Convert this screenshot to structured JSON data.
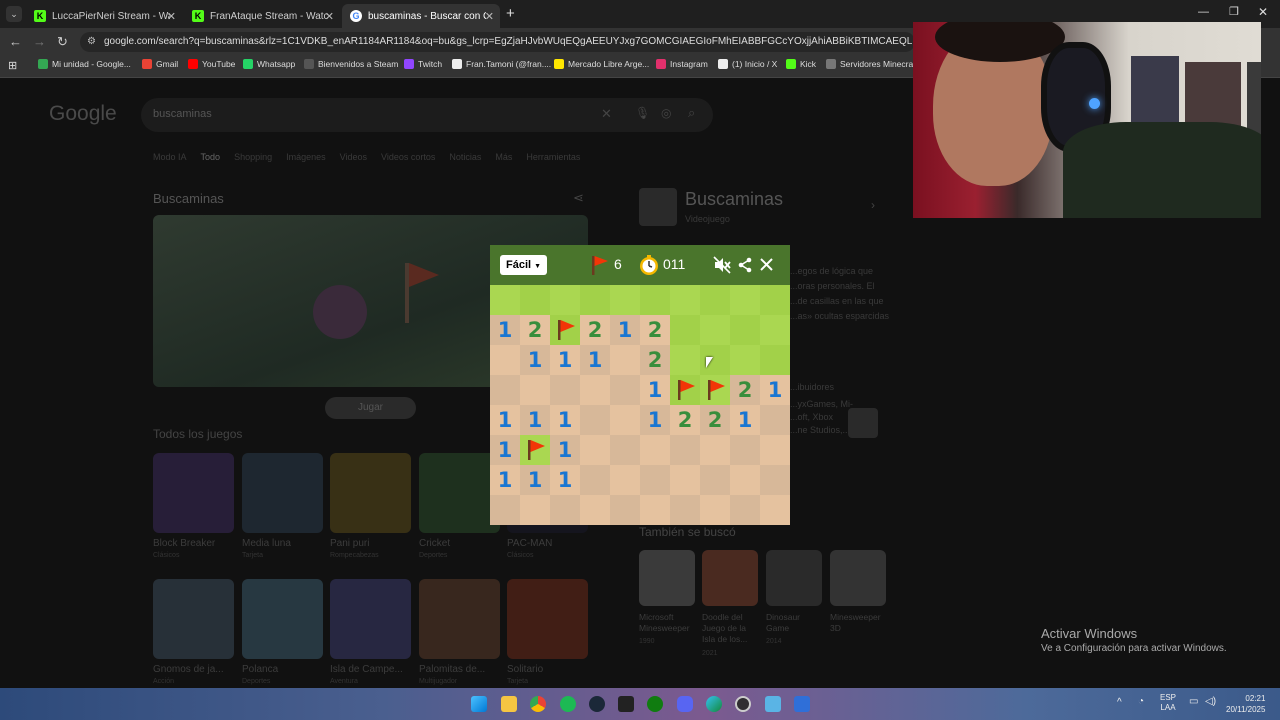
{
  "browser": {
    "tabs": [
      {
        "title": "LuccaPierNeri Stream - Watch L",
        "favicon_color": "#53fc18"
      },
      {
        "title": "FranAtaque Stream - Watch Live",
        "favicon_color": "#53fc18"
      },
      {
        "title": "buscaminas - Buscar con Goog",
        "favicon_color": "#ffffff"
      }
    ],
    "new_tab": "+",
    "url": "google.com/search?q=buscaminas&rlz=1C1VDKB_enAR1184AR1184&oq=bu&gs_lcrp=EgZjaHJvbWUqEQgAEEUYJxg7GOMCGIAEGIoFMhEIABBFGCcYOxjjAhiABBiKBTIMCAEQLhgnGIAEGIoFMg8IARAA",
    "bookmarks": [
      {
        "label": "Mi unidad - Google...",
        "color": "#34a853"
      },
      {
        "label": "Gmail",
        "color": "#ea4335"
      },
      {
        "label": "YouTube",
        "color": "#ff0000"
      },
      {
        "label": "Whatsapp",
        "color": "#25d366"
      },
      {
        "label": "Bienvenidos a Steam",
        "color": "#1b2838"
      },
      {
        "label": "Twitch",
        "color": "#9146ff"
      },
      {
        "label": "Fran.Tamoni (@fran....",
        "color": "#000000"
      },
      {
        "label": "Mercado Libre Arge...",
        "color": "#ffe600"
      },
      {
        "label": "Instagram",
        "color": "#e1306c"
      },
      {
        "label": "(1) Inicio / X",
        "color": "#000000"
      },
      {
        "label": "Kick",
        "color": "#53fc18"
      },
      {
        "label": "Servidores Minecraf...",
        "color": "#777777"
      }
    ]
  },
  "search": {
    "logo": "Google",
    "query": "buscaminas",
    "nav": [
      "Modo IA",
      "Todo",
      "Shopping",
      "Imágenes",
      "Videos",
      "Videos cortos",
      "Noticias",
      "Más",
      "Herramientas"
    ],
    "game_title": "Buscaminas",
    "play_button": "Jugar",
    "all_games_heading": "Todos los juegos",
    "games": [
      {
        "name": "Block Breaker",
        "sub": "Clásicos",
        "color": "#3a2a5a"
      },
      {
        "name": "Media luna",
        "sub": "Tarjeta",
        "color": "#2a3a4a"
      },
      {
        "name": "Pani puri",
        "sub": "Rompecabezas",
        "color": "#5a4a1a"
      },
      {
        "name": "Cricket",
        "sub": "Deportes",
        "color": "#2a4a2a"
      },
      {
        "name": "PAC-MAN",
        "sub": "Clásicos",
        "color": "#1a1a2a"
      },
      {
        "name": "Gnomos de ja...",
        "sub": "Acción",
        "color": "#3a4a5a"
      },
      {
        "name": "Polanca",
        "sub": "Deportes",
        "color": "#3a5a6a"
      },
      {
        "name": "Isla de Campe...",
        "sub": "Aventura",
        "color": "#3a3a6a"
      },
      {
        "name": "Palomitas de...",
        "sub": "Multijugador",
        "color": "#5a3a2a"
      },
      {
        "name": "Solitario",
        "sub": "Tarjeta",
        "color": "#6a2a1a"
      }
    ],
    "kp_title": "Buscaminas",
    "kp_sub": "Videojuego",
    "kp_desc": [
      "...egos de lógica que",
      "...oras personales. El",
      "...de casillas en las que",
      "...as» ocultas esparcidas"
    ],
    "kp_devs_label": "...ibuidores",
    "kp_devs": [
      "...yxGames, Mi-",
      "...oft, Xbox",
      "...ne Studios,..."
    ],
    "also_heading": "También se buscó",
    "also": [
      {
        "name": "Microsoft Minesweeper",
        "year": "1990"
      },
      {
        "name": "Doodle del Juego de la Isla de los...",
        "year": "2021"
      },
      {
        "name": "Dinosaur Game",
        "year": "2014"
      },
      {
        "name": "Minesweeper 3D",
        "year": ""
      }
    ]
  },
  "minesweeper": {
    "difficulty": "Fácil",
    "flags_left": "6",
    "timer": "011",
    "rows": [
      [
        "g",
        "g",
        "g",
        "g",
        "g",
        "g",
        "g",
        "g",
        "g",
        "g"
      ],
      [
        "1",
        "2",
        "F",
        "2",
        "1",
        "2",
        "g",
        "g",
        "g",
        "g"
      ],
      [
        "0",
        "1",
        "1",
        "1",
        "0",
        "2",
        "g",
        "g",
        "g",
        "g"
      ],
      [
        "0",
        "0",
        "0",
        "0",
        "0",
        "1",
        "F",
        "F",
        "2",
        "1"
      ],
      [
        "1",
        "1",
        "1",
        "0",
        "0",
        "1",
        "2",
        "2",
        "1",
        "0"
      ],
      [
        "1",
        "F",
        "1",
        "0",
        "0",
        "0",
        "0",
        "0",
        "0",
        "0"
      ],
      [
        "1",
        "1",
        "1",
        "0",
        "0",
        "0",
        "0",
        "0",
        "0",
        "0"
      ],
      [
        "0",
        "0",
        "0",
        "0",
        "0",
        "0",
        "0",
        "0",
        "0",
        "0"
      ]
    ],
    "colors": {
      "grass_a": "#aad751",
      "grass_b": "#a2d149",
      "dirt_a": "#e5c29f",
      "dirt_b": "#d7b899",
      "header": "#4a752c",
      "flag": "#f23607"
    }
  },
  "windows": {
    "watermark_title": "Activar Windows",
    "watermark_sub": "Ve a Configuración para activar Windows.",
    "lang": "ESP",
    "lang_sub": "LAA",
    "time": "02:21",
    "date": "20/11/2025"
  }
}
